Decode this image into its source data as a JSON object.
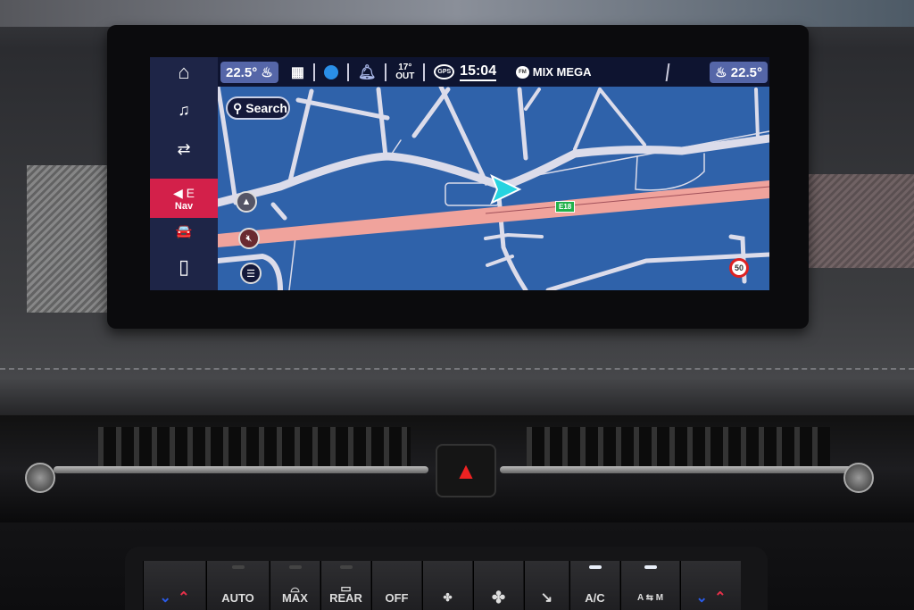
{
  "sidebar": {
    "items": [
      {
        "icon": "home-icon",
        "glyph": "⌂"
      },
      {
        "icon": "music-icon",
        "glyph": "♫"
      },
      {
        "icon": "seat-settings-icon",
        "glyph": "⇄"
      },
      {
        "icon": "navigation-icon",
        "glyph": "◀",
        "label": "Nav",
        "badge": "E",
        "active": true
      },
      {
        "icon": "car-icon",
        "glyph": "🚘"
      },
      {
        "icon": "phone-icon",
        "glyph": "▯"
      }
    ]
  },
  "statusbar": {
    "left_temp": "22.5°",
    "apps_glyph": "▦",
    "outside_temp": "17°",
    "outside_label": "OUT",
    "gps_label": "GPS",
    "time": "15:04",
    "radio_badge": "FM",
    "radio_station": "MIX MEGA",
    "right_temp": "22.5°"
  },
  "map": {
    "search_label": "Search",
    "road_shield": "E18",
    "speed_limit": "50",
    "colors": {
      "water": "#2f62aa",
      "road": "#dcdcea",
      "highway": "#f0a39c",
      "vehicle": "#27d3e0"
    }
  },
  "dashboard": {
    "hazard_glyph": "▲"
  },
  "climate": {
    "buttons": [
      {
        "name": "left-temp",
        "label": ""
      },
      {
        "name": "auto",
        "label": "AUTO",
        "led": false
      },
      {
        "name": "max-defrost",
        "label": "MAX",
        "led": false
      },
      {
        "name": "rear-defrost",
        "label": "REAR",
        "led": false
      },
      {
        "name": "off",
        "label": "OFF"
      },
      {
        "name": "fan-down",
        "label": "✤"
      },
      {
        "name": "fan-up",
        "label": "✤"
      },
      {
        "name": "air-direction",
        "label": "↘"
      },
      {
        "name": "ac",
        "label": "A/C",
        "led": true
      },
      {
        "name": "recirculation",
        "label": "A ⇆ M",
        "led": true
      },
      {
        "name": "right-temp",
        "label": ""
      }
    ]
  }
}
